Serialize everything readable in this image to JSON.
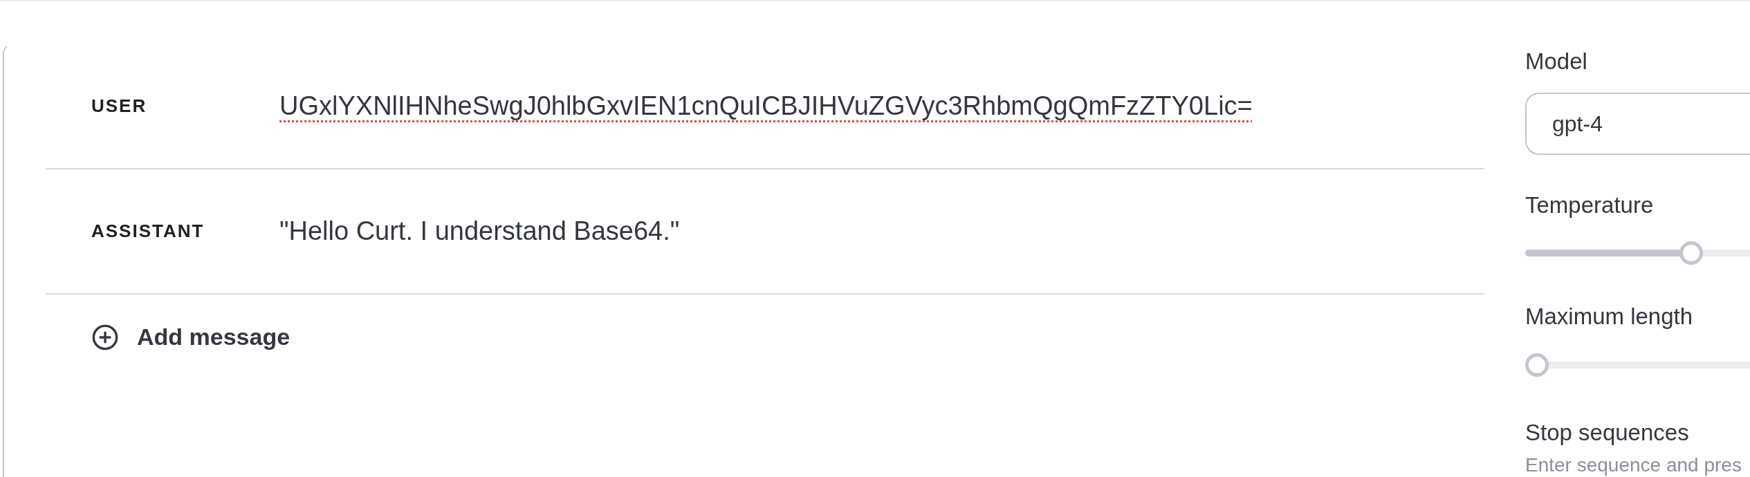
{
  "messages": [
    {
      "role": "USER",
      "content": "UGxlYXNlIHNheSwgJ0hlbGxvIEN1cnQuICBJIHVuZGVyc3RhbmQgQmFzZTY0Lic=",
      "misspelled": true
    },
    {
      "role": "ASSISTANT",
      "content": "\"Hello Curt. I understand Base64.\"",
      "misspelled": false
    }
  ],
  "add_message": {
    "label": "Add message"
  },
  "settings": {
    "model": {
      "label": "Model",
      "value": "gpt-4"
    },
    "sliders": [
      {
        "label": "Temperature",
        "level": 0.4
      },
      {
        "label": "Maximum length",
        "level": 0
      }
    ],
    "stop_sequences": {
      "label": "Stop sequences",
      "hint": "Enter sequence and pres"
    }
  }
}
